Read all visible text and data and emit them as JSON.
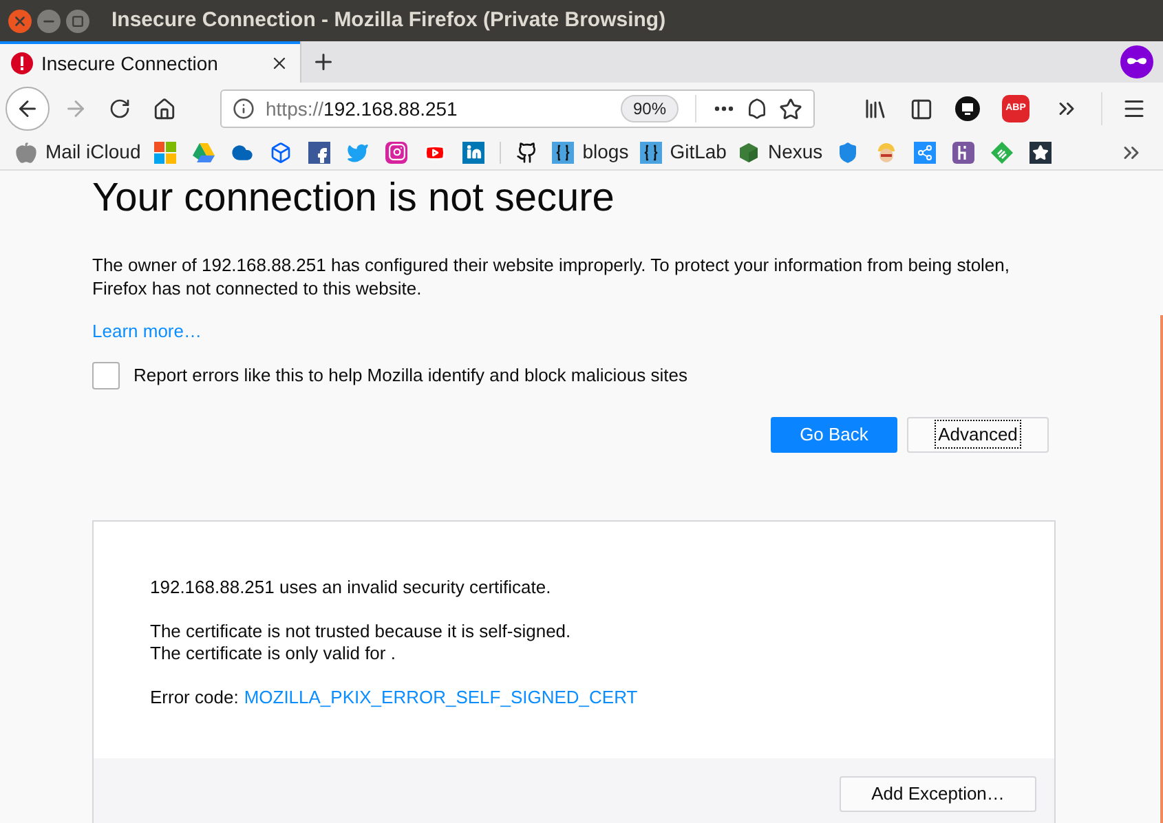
{
  "window": {
    "title": "Insecure Connection - Mozilla Firefox (Private Browsing)"
  },
  "tabs": [
    {
      "label": "Insecure Connection",
      "selected": true
    }
  ],
  "url_bar": {
    "scheme": "https://",
    "host": "192.168.88.251",
    "zoom": "90%"
  },
  "toolbar": {
    "adblock_label": "ABP"
  },
  "bookmarks": [
    {
      "kind": "apple",
      "label": "Mail iCloud"
    },
    {
      "kind": "windows"
    },
    {
      "kind": "drive"
    },
    {
      "kind": "cloud"
    },
    {
      "kind": "dropbox"
    },
    {
      "kind": "facebook"
    },
    {
      "kind": "twitter"
    },
    {
      "kind": "instagram"
    },
    {
      "kind": "youtube"
    },
    {
      "kind": "linkedin"
    },
    {
      "kind": "separator"
    },
    {
      "kind": "github"
    },
    {
      "kind": "braces",
      "label": "blogs"
    },
    {
      "kind": "braces",
      "label": "GitLab"
    },
    {
      "kind": "cube",
      "label": "Nexus"
    },
    {
      "kind": "shield"
    },
    {
      "kind": "worker"
    },
    {
      "kind": "share"
    },
    {
      "kind": "heroku"
    },
    {
      "kind": "feedly"
    },
    {
      "kind": "star"
    }
  ],
  "page": {
    "heading": "Your connection is not secure",
    "description": "The owner of 192.168.88.251 has configured their website improperly. To protect your information from being stolen, Firefox has not connected to this website.",
    "learn_more": "Learn more…",
    "report_checkbox": {
      "label": "Report errors like this to help Mozilla identify and block malicious sites",
      "checked": false
    },
    "buttons": [
      {
        "kind": "primary",
        "label": "Go Back",
        "focused": false
      },
      {
        "kind": "secondary",
        "label": "Advanced",
        "focused": true
      }
    ],
    "advanced_panel": {
      "lines": [
        "192.168.88.251 uses an invalid security certificate.",
        "The certificate is not trusted because it is self-signed.",
        "The certificate is only valid for ."
      ],
      "error_label": "Error code:",
      "error_code": "MOZILLA_PKIX_ERROR_SELF_SIGNED_CERT",
      "button": "Add Exception…"
    }
  }
}
